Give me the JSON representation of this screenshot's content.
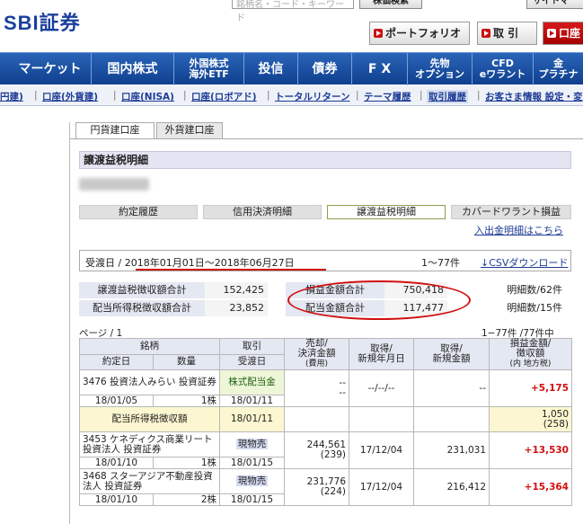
{
  "header": {
    "logo": "SBI証券",
    "search_placeholder": "銘柄名・コード・キーワード",
    "stock_search_label": "株価検索",
    "sitemap_label": "サイトマ",
    "portfolio_label": "ポートフォリオ",
    "trade_label": "取 引",
    "account_label": "口座"
  },
  "nav": {
    "items": [
      "マーケット",
      "国内株式",
      "外国株式",
      "海外ETF",
      "投信",
      "債券",
      "F X",
      "先物",
      "オプション",
      "CFD",
      "eワラント",
      "金",
      "プラチナ"
    ]
  },
  "subnav": {
    "items": [
      "円建)",
      "口座(外貨建)",
      "口座(NISA)",
      "口座(ロボアド)",
      "トータルリターン",
      "テーマ履歴",
      "取引履歴",
      "お客さま情報 設定・変"
    ]
  },
  "tabs": {
    "yen": "円貨建口座",
    "foreign": "外貨建口座"
  },
  "section_title": "譲渡益税明細",
  "subtabs": [
    "約定履歴",
    "信用決済明細",
    "譲渡益税明細",
    "カバードワラント損益"
  ],
  "deposit_link": "入出金明細はこちら",
  "period": {
    "label": "受渡日 /",
    "range": "2018年01月01日〜2018年06月27日",
    "count": "1〜77件",
    "csv_link": "CSVダウンロード"
  },
  "summary": {
    "rows": [
      {
        "l1": "譲渡益税徴収額合計",
        "v1": "152,425",
        "l2": "損益金額合計",
        "v2": "750,418",
        "l3": "明細数/62件"
      },
      {
        "l1": "配当所得税徴収額合計",
        "v1": "23,852",
        "l2": "配当金額合計",
        "v2": "117,477",
        "l3": "明細数/15件"
      }
    ]
  },
  "pagination": {
    "page": "ページ / 1",
    "range": "1−77件 /77件中"
  },
  "table": {
    "headers": {
      "issue": "銘柄",
      "trade": "取引",
      "sale": "売却/",
      "sale2": "決済金額",
      "sale_sub": "(費用)",
      "acq_date": "取得/",
      "acq_date2": "新規年月日",
      "acq_amt": "取得/",
      "acq_amt2": "新規金額",
      "pl": "損益金額/",
      "pl2": "徴収額",
      "pl_sub": "(内 地方税)",
      "exec_date": "約定日",
      "qty": "数量",
      "delivery": "受渡日"
    },
    "rows": [
      {
        "name": "3476 投資法人みらい 投資証券",
        "trade": "株式配当金",
        "sale1": "--",
        "sale2": "--",
        "acq_date": "--/--/--",
        "acq_amt": "--",
        "pl": "+5,175",
        "exec_date": "18/01/05",
        "qty": "1株",
        "delivery": "18/01/11"
      },
      {
        "name": "3453 ケネディクス商業リート投資法人 投資証券",
        "trade": "現物売",
        "sale1": "244,561",
        "sale2": "(239)",
        "acq_date": "17/12/04",
        "acq_amt": "231,031",
        "pl": "+13,530",
        "exec_date": "18/01/10",
        "qty": "1株",
        "delivery": "18/01/15"
      },
      {
        "name": "3468 スターアジア不動産投資法人 投資証券",
        "trade": "現物売",
        "sale1": "231,776",
        "sale2": "(224)",
        "acq_date": "17/12/04",
        "acq_amt": "216,412",
        "pl": "+15,364",
        "exec_date": "18/01/10",
        "qty": "2株",
        "delivery": "18/01/15"
      }
    ],
    "dividend_tax": {
      "label": "配当所得税徴収額",
      "date": "18/01/11",
      "amount": "1,050",
      "local": "(258)"
    }
  }
}
